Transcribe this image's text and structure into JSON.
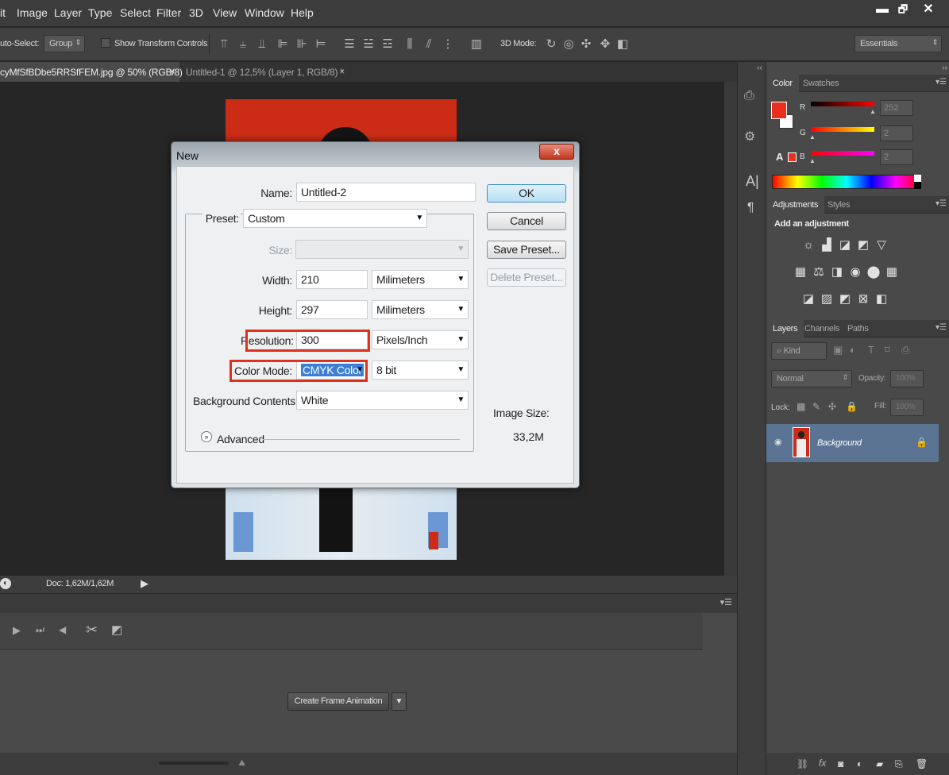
{
  "menu": [
    "it",
    "Image",
    "Layer",
    "Type",
    "Select",
    "Filter",
    "3D",
    "View",
    "Window",
    "Help"
  ],
  "window_controls": {
    "minimize": "▬",
    "restore": "🗗",
    "close": "✕"
  },
  "options": {
    "auto_select_label": "uto-Select:",
    "auto_select_value": "Group",
    "show_transform_label": "Show Transform Controls",
    "mode_3d_label": "3D Mode:",
    "workspace": "Essentials"
  },
  "tabs": [
    {
      "label": "cyMfSfBDbe5RRSfFEM.jpg @ 50% (RGB/8)",
      "close": "×",
      "active": true
    },
    {
      "label": "Untitled-1 @ 12,5% (Layer 1, RGB/8) *",
      "close": "×",
      "active": false
    }
  ],
  "status": {
    "doc": "Doc: 1,62M/1,62M"
  },
  "timeline": {
    "create_button": "Create Frame Animation"
  },
  "dialog": {
    "title": "New",
    "close": "x",
    "name_label": "Name:",
    "name_value": "Untitled-2",
    "preset_label": "Preset:",
    "preset_value": "Custom",
    "size_label": "Size:",
    "size_value": "",
    "width_label": "Width:",
    "width_value": "210",
    "width_unit": "Milimeters",
    "height_label": "Height:",
    "height_value": "297",
    "height_unit": "Milimeters",
    "resolution_label": "Resolution:",
    "resolution_value": "300",
    "resolution_unit": "Pixels/Inch",
    "colormode_label": "Color Mode:",
    "colormode_value": "CMYK Color",
    "bitdepth_value": "8 bit",
    "background_label": "Background Contents:",
    "background_value": "White",
    "advanced_label": "Advanced",
    "ok": "OK",
    "cancel": "Cancel",
    "save_preset": "Save Preset...",
    "delete_preset": "Delete Preset...",
    "image_size_label": "Image Size:",
    "image_size_value": "33,2M"
  },
  "color_panel": {
    "tabs": [
      "Color",
      "Swatches"
    ],
    "r_label": "R",
    "g_label": "G",
    "b_label": "B",
    "r_value": "252",
    "g_value": "2",
    "b_value": "2",
    "foreground": "#e8301c"
  },
  "adjustments_panel": {
    "tabs": [
      "Adjustments",
      "Styles"
    ],
    "heading": "Add an adjustment"
  },
  "layers_panel": {
    "tabs": [
      "Layers",
      "Channels",
      "Paths"
    ],
    "kind_label": "Kind",
    "blend_mode": "Normal",
    "opacity_label": "Opacity:",
    "opacity_value": "100%",
    "lock_label": "Lock:",
    "fill_label": "Fill:",
    "fill_value": "100%",
    "layer_name": "Background"
  },
  "colors": {
    "accent_red": "#e0301e",
    "selection_blue": "#3d7fd6",
    "layer_row": "#5b7493"
  }
}
